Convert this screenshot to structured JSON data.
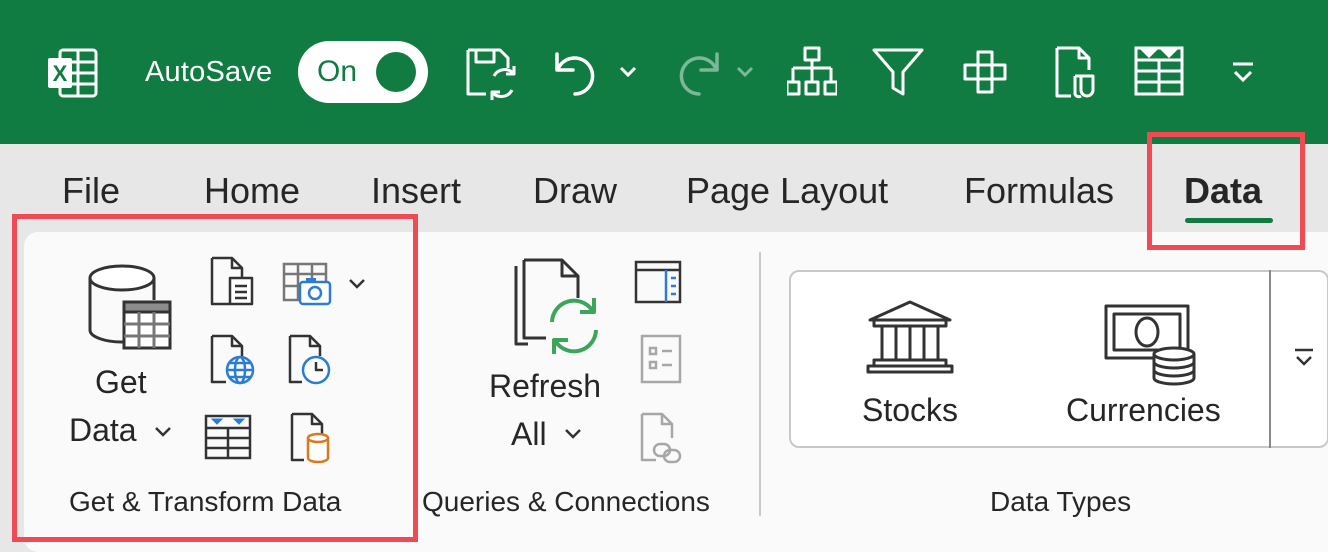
{
  "titlebar": {
    "app_icon": "excel-logo-icon",
    "autosave_label": "AutoSave",
    "autosave_state": "On",
    "quick_access": [
      {
        "name": "save-icon"
      },
      {
        "name": "undo-icon"
      },
      {
        "name": "redo-icon"
      },
      {
        "name": "hierarchy-icon"
      },
      {
        "name": "filter-icon"
      },
      {
        "name": "crosshair-icon"
      },
      {
        "name": "document-script-icon"
      },
      {
        "name": "table-icon"
      },
      {
        "name": "customize-toolbar-icon"
      }
    ],
    "accent_color": "#107c41"
  },
  "tabs": [
    {
      "label": "File"
    },
    {
      "label": "Home"
    },
    {
      "label": "Insert"
    },
    {
      "label": "Draw"
    },
    {
      "label": "Page Layout"
    },
    {
      "label": "Formulas"
    },
    {
      "label": "Data",
      "active": true
    }
  ],
  "ribbon": {
    "get_transform": {
      "get_data_line1": "Get",
      "get_data_line2": "Data",
      "group_label": "Get & Transform Data"
    },
    "queries": {
      "refresh_line1": "Refresh",
      "refresh_line2": "All",
      "group_label": "Queries & Connections"
    },
    "data_types": {
      "stocks": "Stocks",
      "currencies": "Currencies",
      "group_label": "Data Types"
    }
  },
  "highlight_color": "#f04b55"
}
